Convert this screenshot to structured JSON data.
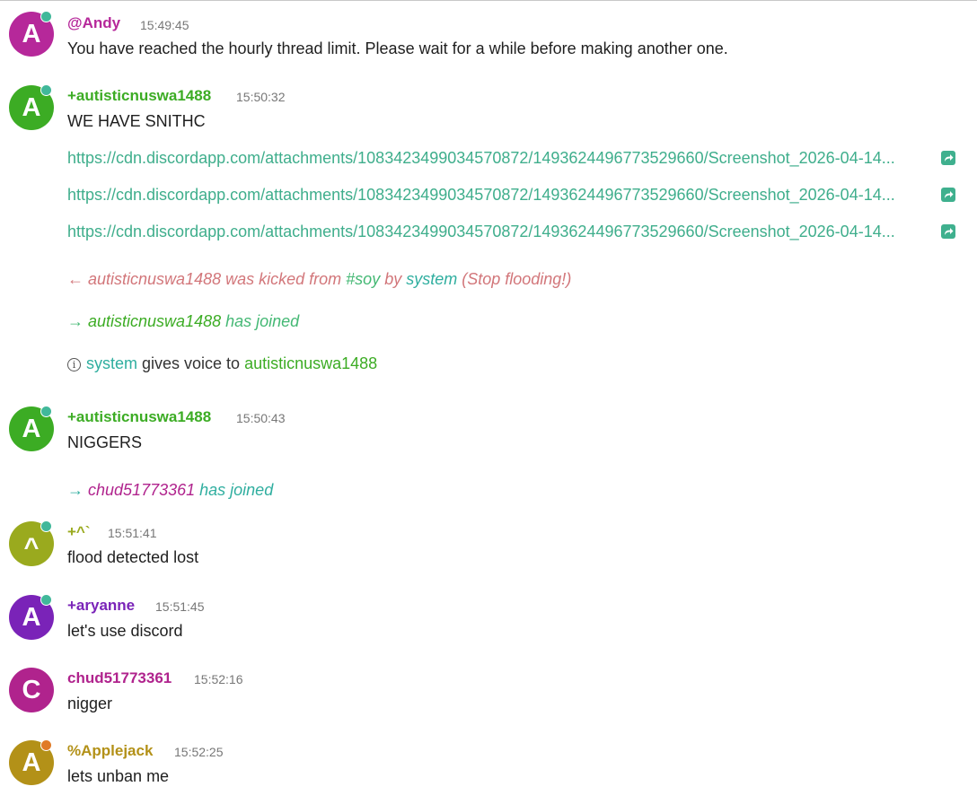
{
  "colors": {
    "andy": "#b6289a",
    "autistic": "#3cac24",
    "caret": "#9aaa1e",
    "aryanne": "#7a23b8",
    "chud": "#b0238d",
    "applejack": "#b39118",
    "link": "#3fae8c",
    "kick": "#d2767a",
    "join": "#44b874",
    "system": "#2fae9f",
    "online_dot": "#41b89a",
    "away_dot": "#e07b28"
  },
  "messages": [
    {
      "avatar": "A",
      "nick": "@Andy",
      "time": "15:49:45",
      "text": "You have reached the hourly thread limit. Please wait for a while before making another one."
    },
    {
      "avatar": "A",
      "nick": "+autisticnuswa1488",
      "time": "15:50:32",
      "text": "WE HAVE SNITHC",
      "links": [
        "https://cdn.discordapp.com/attachments/1083423499034570872/1493624496773529660/Screenshot_2026-04-14...",
        "https://cdn.discordapp.com/attachments/1083423499034570872/1493624496773529660/Screenshot_2026-04-14...",
        "https://cdn.discordapp.com/attachments/1083423499034570872/1493624496773529660/Screenshot_2026-04-14..."
      ],
      "link_icon": "share-arrow-icon"
    },
    {
      "avatar": "A",
      "nick": "+autisticnuswa1488",
      "time": "15:50:43",
      "text": "NIGGERS"
    },
    {
      "avatar": "^",
      "nick": "+^`",
      "time": "15:51:41",
      "text": "flood detected lost"
    },
    {
      "avatar": "A",
      "nick": "+aryanne",
      "time": "15:51:45",
      "text": "let's use discord"
    },
    {
      "avatar": "C",
      "nick": "chud51773361",
      "time": "15:52:16",
      "text": "nigger"
    },
    {
      "avatar": "A",
      "nick": "%Applejack",
      "time": "15:52:25",
      "text": "lets unban me"
    }
  ],
  "events": {
    "kick": {
      "arrow": "←",
      "user": "autisticnuswa1488",
      "was_kicked_from": " was kicked from ",
      "channel": "#soy",
      "by": " by ",
      "kicker": "system",
      "reason": " (Stop flooding!)"
    },
    "join1": {
      "arrow": "→",
      "user": "autisticnuswa1488",
      "has_joined": " has joined"
    },
    "voice": {
      "icon": "info-icon",
      "actor": "system",
      "gives_voice_to": " gives voice to ",
      "target": "autisticnuswa1488"
    },
    "join2": {
      "arrow": "→",
      "user": "chud51773361",
      "has_joined": " has joined"
    }
  }
}
